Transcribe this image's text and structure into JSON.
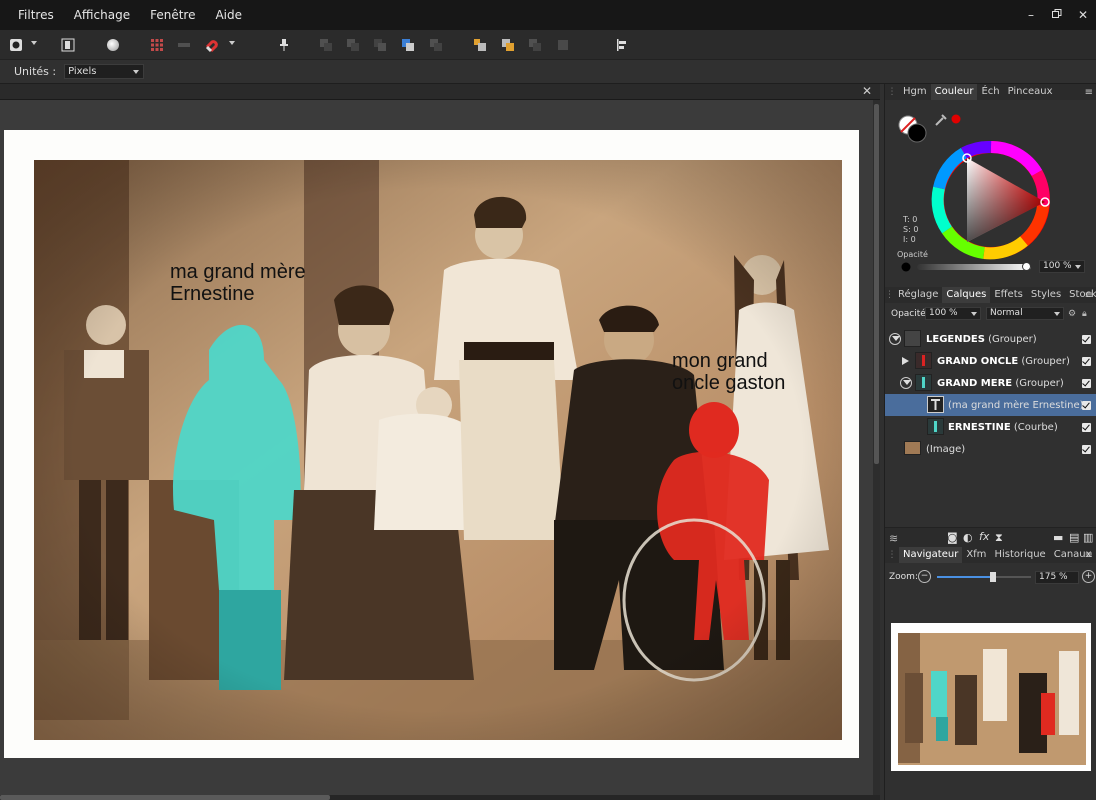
{
  "menubar": {
    "items": [
      "Filtres",
      "Affichage",
      "Fenêtre",
      "Aide"
    ],
    "window_controls": [
      "minimize-icon",
      "restore-icon",
      "close-icon"
    ]
  },
  "context": {
    "units_label": "Unités :",
    "units_value": "Pixels"
  },
  "captions": {
    "grandmother": "ma grand mère\nErnestine",
    "granduncle": "mon grand\noncle gaston"
  },
  "colors": {
    "accent_cyan": "#4fd6c8",
    "accent_red": "#e02a20",
    "selection": "#4a6d9c"
  },
  "color_panel": {
    "tabs": [
      "Hgm",
      "Couleur",
      "Éch",
      "Pinceaux"
    ],
    "active_tab": "Couleur",
    "tsl": [
      "T: 0",
      "S: 0",
      "I: 0"
    ],
    "opacity_label": "Opacité",
    "opacity_value": "100 %",
    "opacity_level": 1.0
  },
  "layers_panel": {
    "tabs": [
      "Réglage",
      "Calques",
      "Effets",
      "Styles",
      "Stock"
    ],
    "active_tab": "Calques",
    "opacity_label": "Opacité:",
    "opacity_value": "100 %",
    "blend_mode": "Normal",
    "layers": [
      {
        "name": "LEGENDES",
        "type": "(Grouper)"
      },
      {
        "name": "GRAND ONCLE",
        "type": "(Grouper)"
      },
      {
        "name": "GRAND MERE",
        "type": "(Grouper)"
      },
      {
        "name": "",
        "type": "(ma grand mère Ernestine)"
      },
      {
        "name": "ERNESTINE",
        "type": "(Courbe)"
      },
      {
        "name": "",
        "type": "(Image)"
      }
    ]
  },
  "navigator_panel": {
    "tabs": [
      "Navigateur",
      "Xfm",
      "Historique",
      "Canaux"
    ],
    "active_tab": "Navigateur",
    "zoom_label": "Zoom:",
    "zoom_value": "175 %",
    "zoom_level": 0.6
  }
}
